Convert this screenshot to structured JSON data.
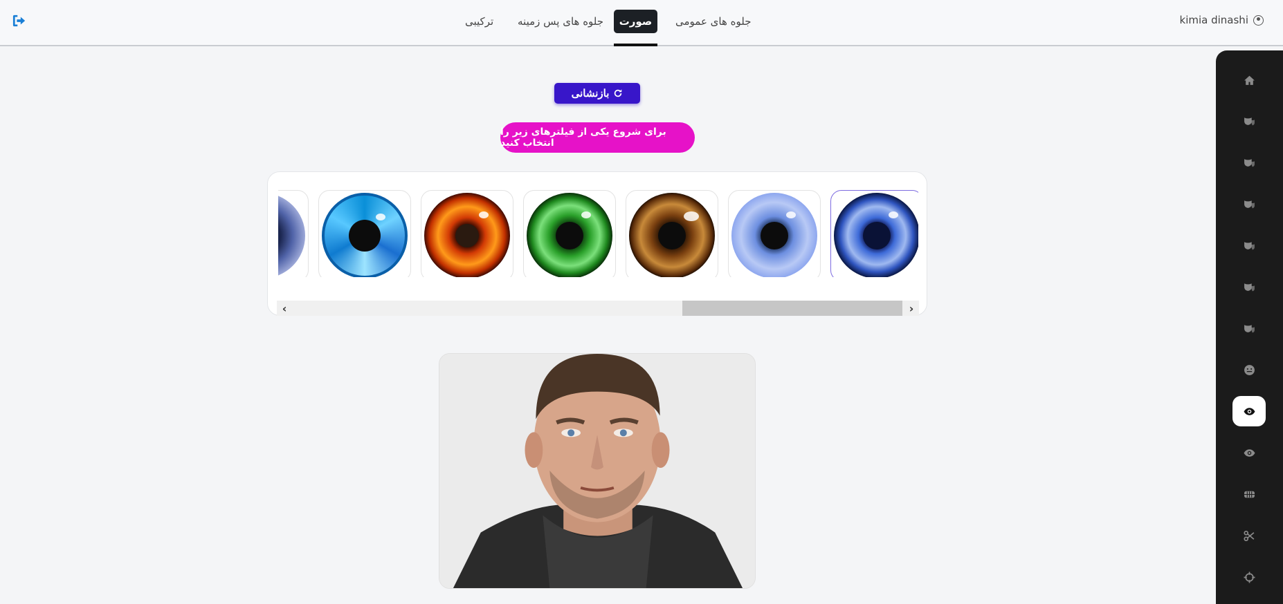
{
  "header": {
    "user_name": "kimia dinashi",
    "tabs": [
      {
        "label": "جلوه های عمومی",
        "active": false
      },
      {
        "label": "صورت",
        "active": true
      },
      {
        "label": "جلوه های پس زمینه",
        "active": false
      },
      {
        "label": "ترکیبی",
        "active": false
      }
    ],
    "icons": {
      "logout": "sign-out-icon",
      "user": "user-circle-icon"
    }
  },
  "actions": {
    "reset_label": "بازنشانی",
    "hint_text": "برای شروع یکی از فیلترهای زیر را انتخاب کنید"
  },
  "filters": {
    "items": [
      {
        "name": "deep-blue-eye",
        "selected": true
      },
      {
        "name": "light-blue-eye",
        "selected": false
      },
      {
        "name": "brown-eye",
        "selected": false
      },
      {
        "name": "green-eye",
        "selected": false
      },
      {
        "name": "fire-eye",
        "selected": false
      },
      {
        "name": "crystal-blue-eye",
        "selected": false
      },
      {
        "name": "partial-eye",
        "selected": false
      }
    ]
  },
  "sidebar": {
    "items": [
      {
        "icon": "home-icon",
        "active": false
      },
      {
        "icon": "mask-icon",
        "active": false
      },
      {
        "icon": "mask-icon",
        "active": false
      },
      {
        "icon": "mask-icon",
        "active": false
      },
      {
        "icon": "mask-icon",
        "active": false
      },
      {
        "icon": "mask-icon",
        "active": false
      },
      {
        "icon": "mask-icon",
        "active": false
      },
      {
        "icon": "face-icon",
        "active": false
      },
      {
        "icon": "eye-icon",
        "active": true
      },
      {
        "icon": "eye-icon",
        "active": false
      },
      {
        "icon": "teeth-icon",
        "active": false
      },
      {
        "icon": "scissors-icon",
        "active": false
      },
      {
        "icon": "crosshair-icon",
        "active": false
      }
    ]
  },
  "colors": {
    "accent": "#3816c9",
    "hint": "#e612c8",
    "sidebar_bg": "#1b1b1b",
    "logout": "#1a7fd6"
  }
}
